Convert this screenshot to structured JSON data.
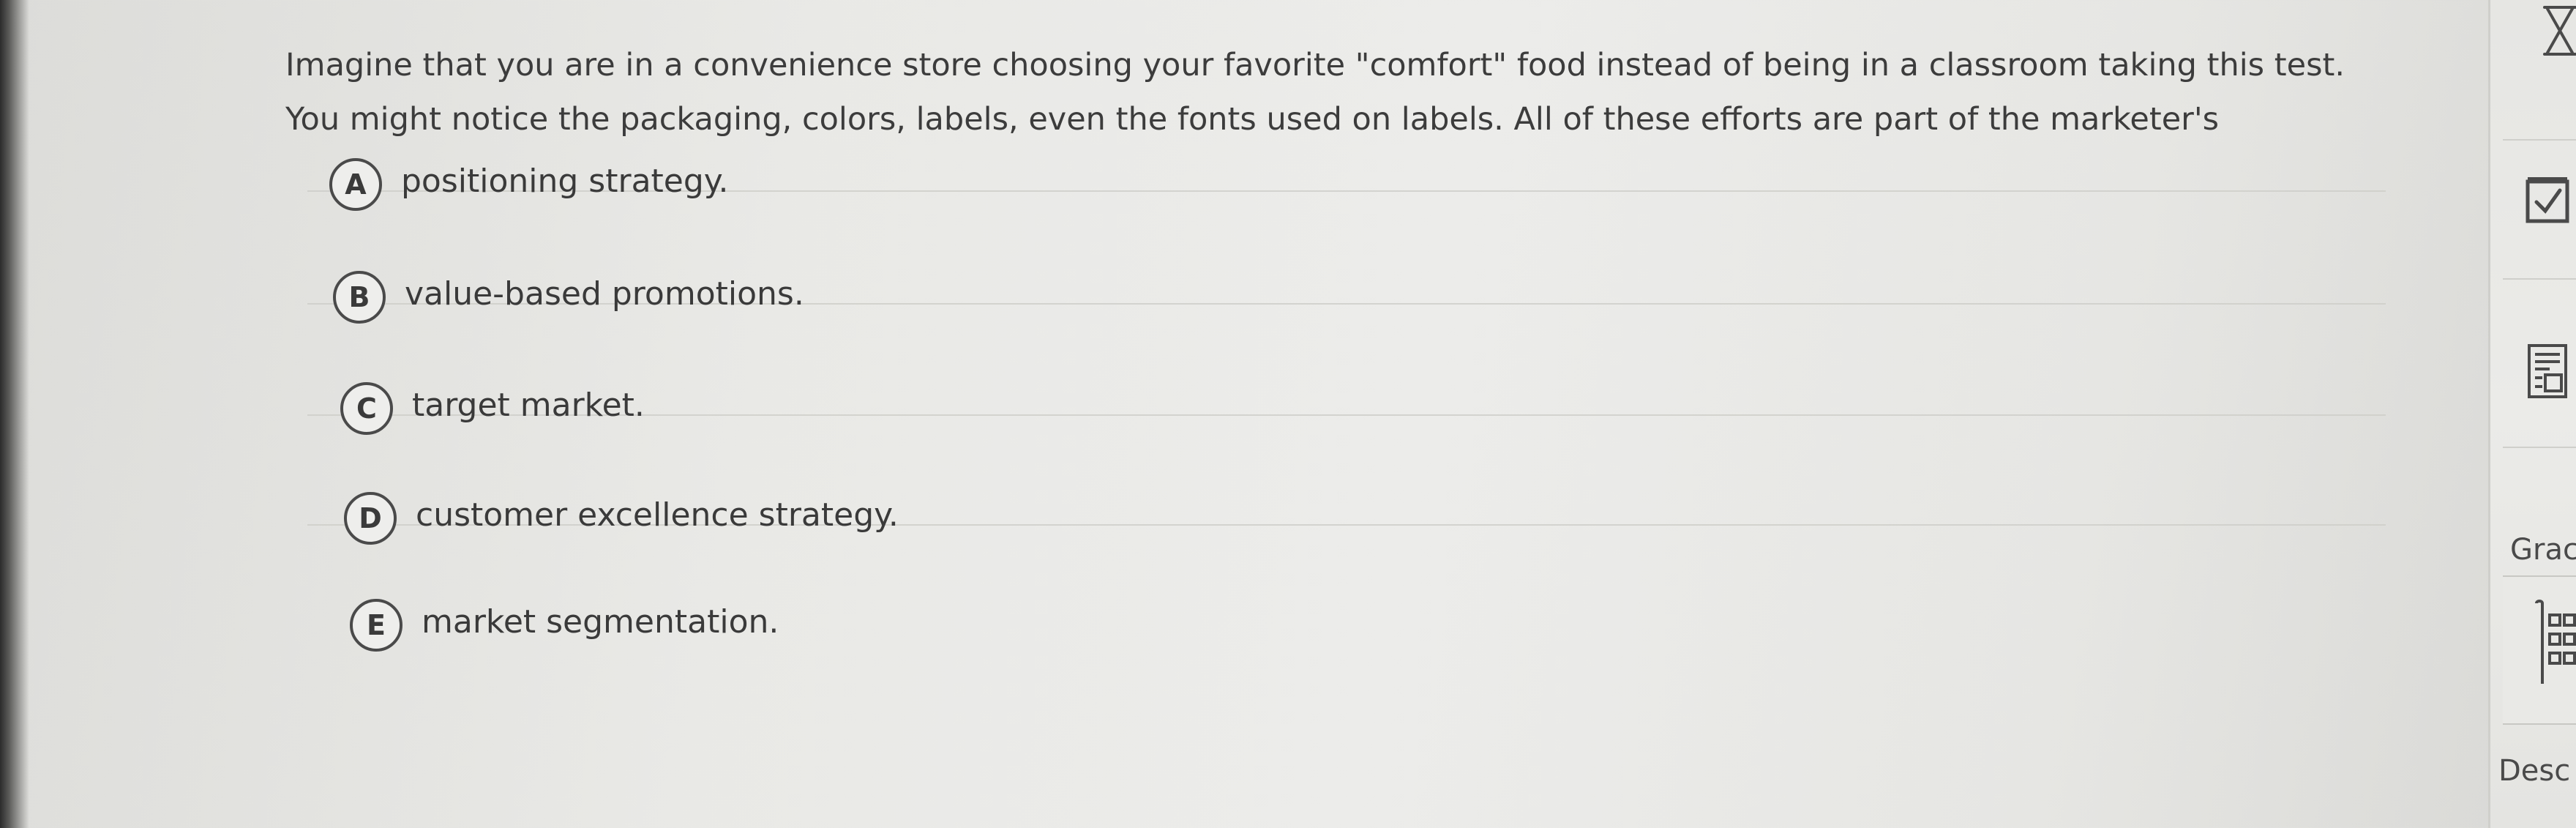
{
  "question": {
    "line1": "Imagine that you are in a convenience store choosing your favorite \"comfort\" food instead of being in a classroom taking this test.",
    "line2": "You might notice the packaging, colors, labels, even the fonts used on labels. All of these efforts are part of the marketer's"
  },
  "answers": [
    {
      "letter": "A",
      "text": "positioning strategy."
    },
    {
      "letter": "B",
      "text": "value-based promotions."
    },
    {
      "letter": "C",
      "text": "target market."
    },
    {
      "letter": "D",
      "text": "customer excellence strategy."
    },
    {
      "letter": "E",
      "text": "market segmentation."
    }
  ],
  "sidebar": {
    "grade_label": "Grac",
    "desc_label": "Desc",
    "icons": [
      "close-icon",
      "checkbox-icon",
      "calculator-icon",
      "grid-icon"
    ]
  }
}
